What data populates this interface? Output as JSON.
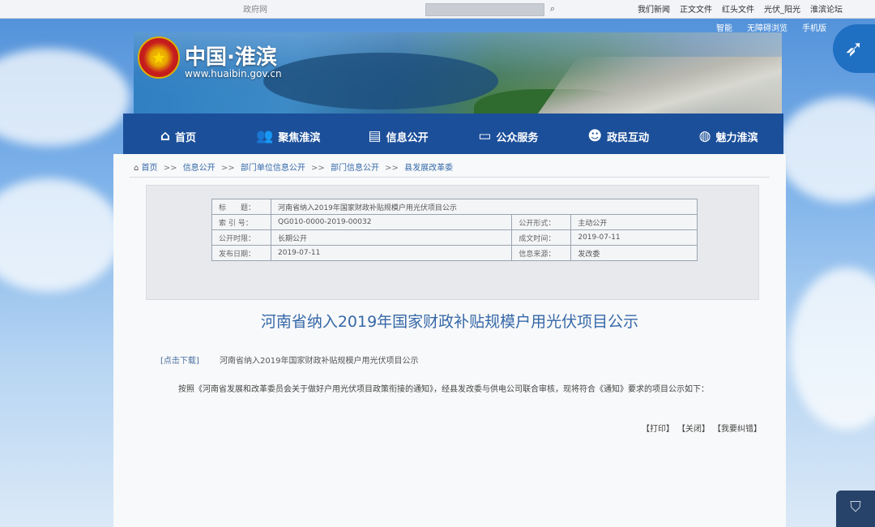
{
  "browser": {
    "faint_link": "政府网",
    "top_links": [
      "我们新闻",
      "正文文件",
      "红头文件",
      "光伏_阳光",
      "淮滨论坛"
    ]
  },
  "site_links": [
    "智能",
    "无障碍浏览",
    "手机版"
  ],
  "header": {
    "logo_text": "中国·淮滨",
    "logo_url": "www.huaibin.gov.cn"
  },
  "nav": {
    "items": [
      {
        "label": "首页",
        "icon": "home-icon"
      },
      {
        "label": "聚焦淮滨",
        "icon": "people-icon"
      },
      {
        "label": "信息公开",
        "icon": "document-icon"
      },
      {
        "label": "公众服务",
        "icon": "monitor-icon"
      },
      {
        "label": "政民互动",
        "icon": "user-chat-icon"
      },
      {
        "label": "魅力淮滨",
        "icon": "globe-icon"
      }
    ]
  },
  "breadcrumb": {
    "items": [
      "首页",
      "信息公开",
      "部门单位信息公开",
      "部门信息公开",
      "县发展改革委"
    ],
    "separator": ">>"
  },
  "meta": {
    "title_label": "标　　题：",
    "title_value": "河南省纳入2019年国家财政补贴规模户用光伏项目公示",
    "index_label": "索 引 号：",
    "index_value": "QG010-0000-2019-00032",
    "open_mode_label": "公开形式：",
    "open_mode_value": "主动公开",
    "open_period_label": "公开时限：",
    "open_period_value": "长期公开",
    "doc_date_label": "成文时间：",
    "doc_date_value": "2019-07-11",
    "publish_date_label": "发布日期：",
    "publish_date_value": "2019-07-11",
    "source_label": "信息来源：",
    "source_value": "发改委"
  },
  "article": {
    "title": "河南省纳入2019年国家财政补贴规模户用光伏项目公示",
    "download_tag": "[点击下载]",
    "download_link": "河南省纳入2019年国家财政补贴规模户用光伏项目公示",
    "paragraph": "按照《河南省发展和改革委员会关于做好户用光伏项目政策衔接的通知》，经县发改委与供电公司联合审核，现将符合《通知》要求的项目公示如下："
  },
  "actions": [
    "【打印】",
    "【关闭】",
    "【我要纠错】"
  ]
}
